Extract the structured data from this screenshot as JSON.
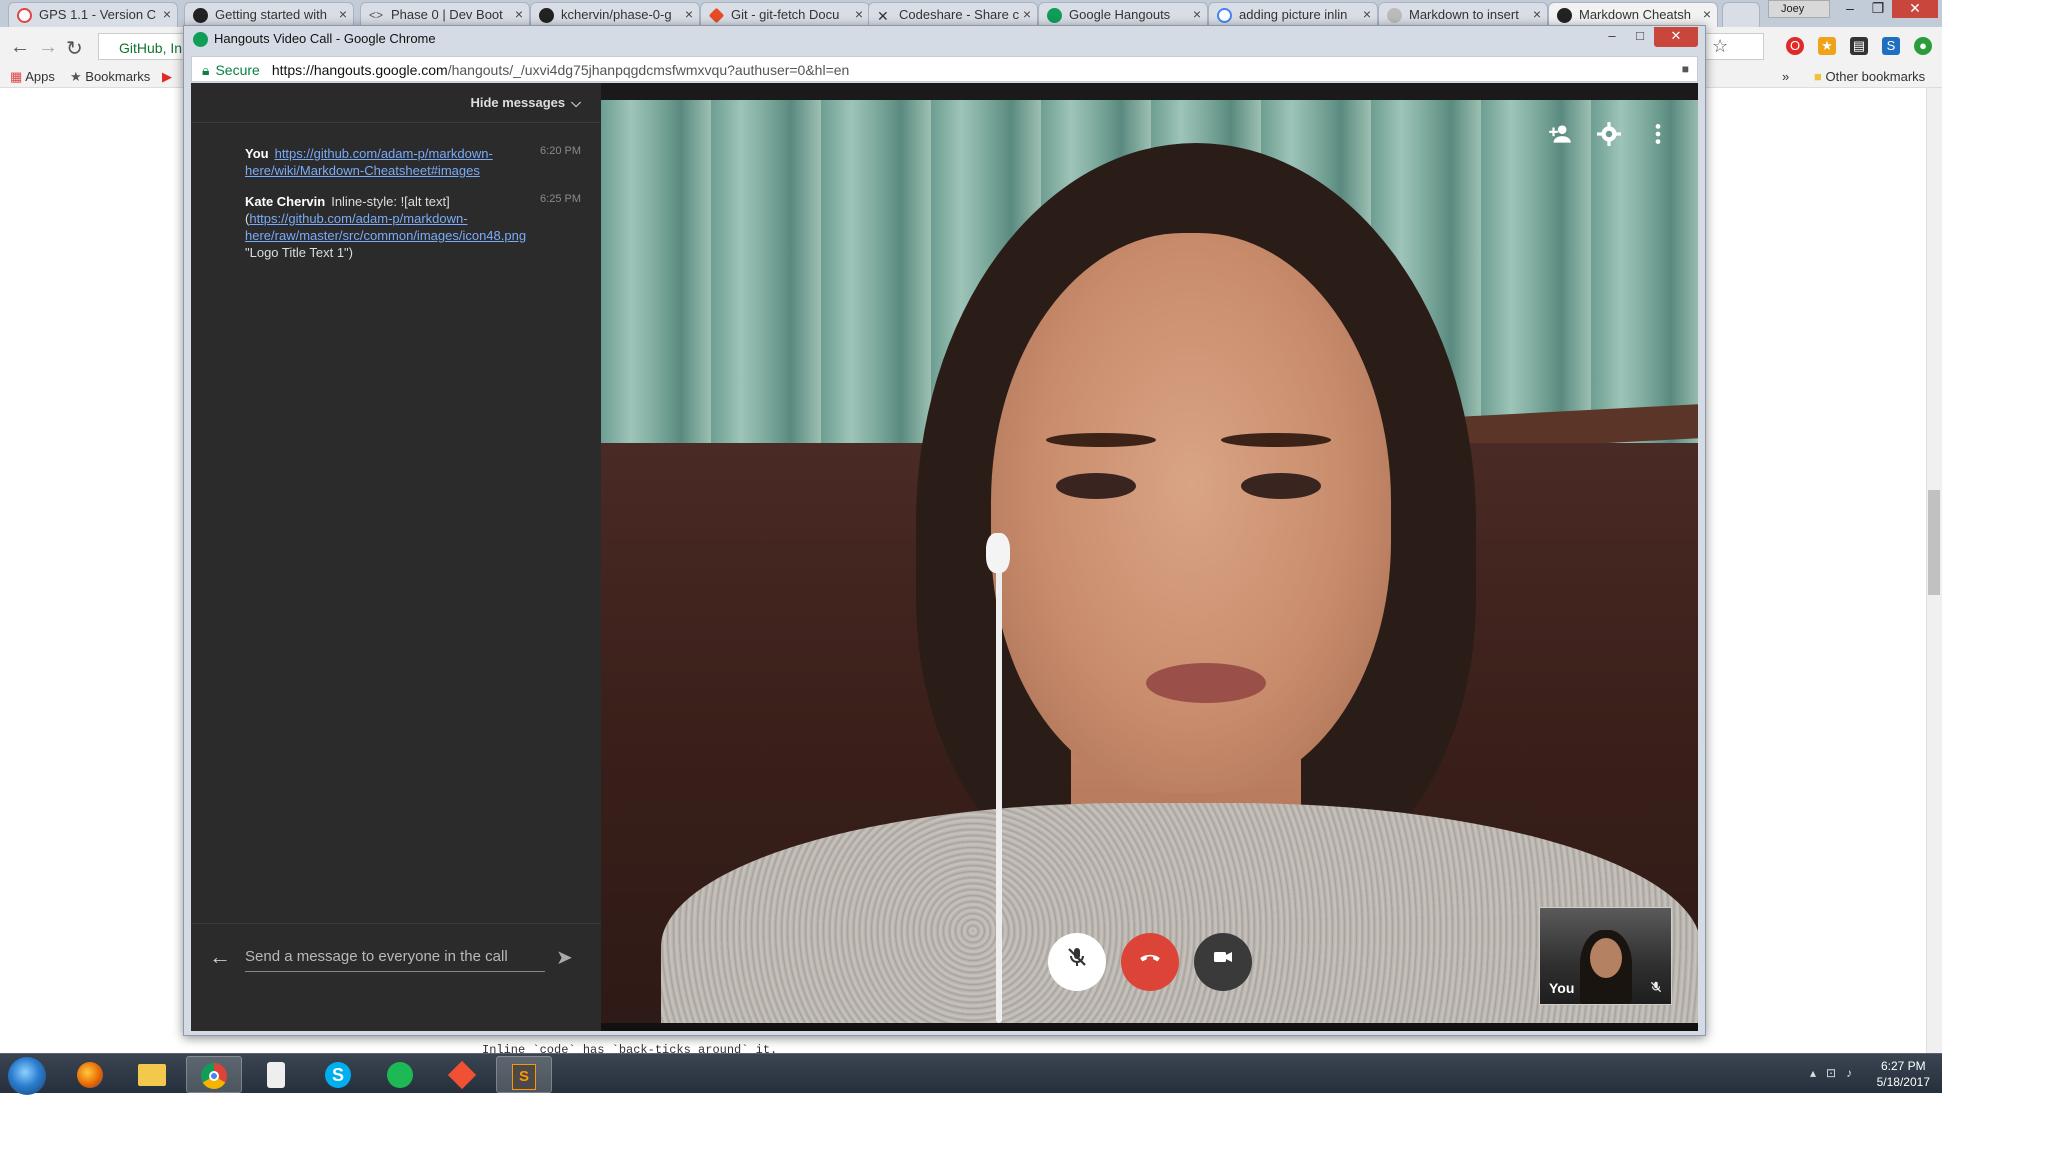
{
  "background_window": {
    "tabs": [
      {
        "label": "GPS 1.1 - Version C",
        "color": "#d44"
      },
      {
        "label": "Getting started with",
        "color": "#222"
      },
      {
        "label": "Phase 0 | Dev Boot",
        "color": "#555"
      },
      {
        "label": "kchervin/phase-0-g",
        "color": "#222"
      },
      {
        "label": "Git - git-fetch Docu",
        "color": "#e44d26"
      },
      {
        "label": "Codeshare - Share c",
        "color": "#333"
      },
      {
        "label": "Google Hangouts",
        "color": "#0f9d58"
      },
      {
        "label": "adding picture inlin",
        "color": "#4285f4"
      },
      {
        "label": "Markdown to insert",
        "color": "#888"
      },
      {
        "label": "Markdown Cheatsh",
        "color": "#222"
      }
    ],
    "os_user": "Joey",
    "url_fragment": "GitHub, In",
    "bookmarks": {
      "apps": "Apps",
      "bookmarks": "Bookmarks",
      "overflow": "»",
      "other": "Other bookmarks"
    },
    "page_text_fragment": "Inline `code` has `back-ticks around` it."
  },
  "hangouts_window": {
    "title": "Hangouts Video Call - Google Chrome",
    "url": {
      "secure_label": "Secure",
      "host": "https://hangouts.google.com",
      "path": "/hangouts/_/uxvi4dg75jhanpqgdcmsfwmxvqu?authuser=0&hl=en"
    },
    "chat": {
      "hide_messages_label": "Hide messages",
      "messages": [
        {
          "sender": "You",
          "text_prefix": "",
          "link": "https://github.com/adam-p/markdown-here/wiki/Markdown-Cheatsheet#images",
          "text_suffix": "",
          "time": "6:20 PM"
        },
        {
          "sender": "Kate Chervin",
          "text_prefix": "Inline-style:  ![alt text] (",
          "link": "https://github.com/adam-p/markdown-here/raw/master/src/common/images/icon48.png",
          "text_suffix": " \"Logo Title Text 1\")",
          "time": "6:25 PM"
        }
      ],
      "input_placeholder": "Send a message to everyone in the call"
    },
    "video": {
      "self_view_label": "You",
      "controls": {
        "mic": "mic-muted-icon",
        "hangup": "hang-up-icon",
        "camera": "video-camera-icon"
      },
      "top_icons": [
        "add-person-icon",
        "settings-icon",
        "more-vert-icon"
      ]
    }
  },
  "taskbar": {
    "apps": [
      "firefox-icon",
      "file-explorer-icon",
      "chrome-icon",
      "sticky-app-icon",
      "skype-icon",
      "spotify-icon",
      "git-icon",
      "sublime-text-icon"
    ],
    "time": "6:27 PM",
    "date": "5/18/2017"
  }
}
